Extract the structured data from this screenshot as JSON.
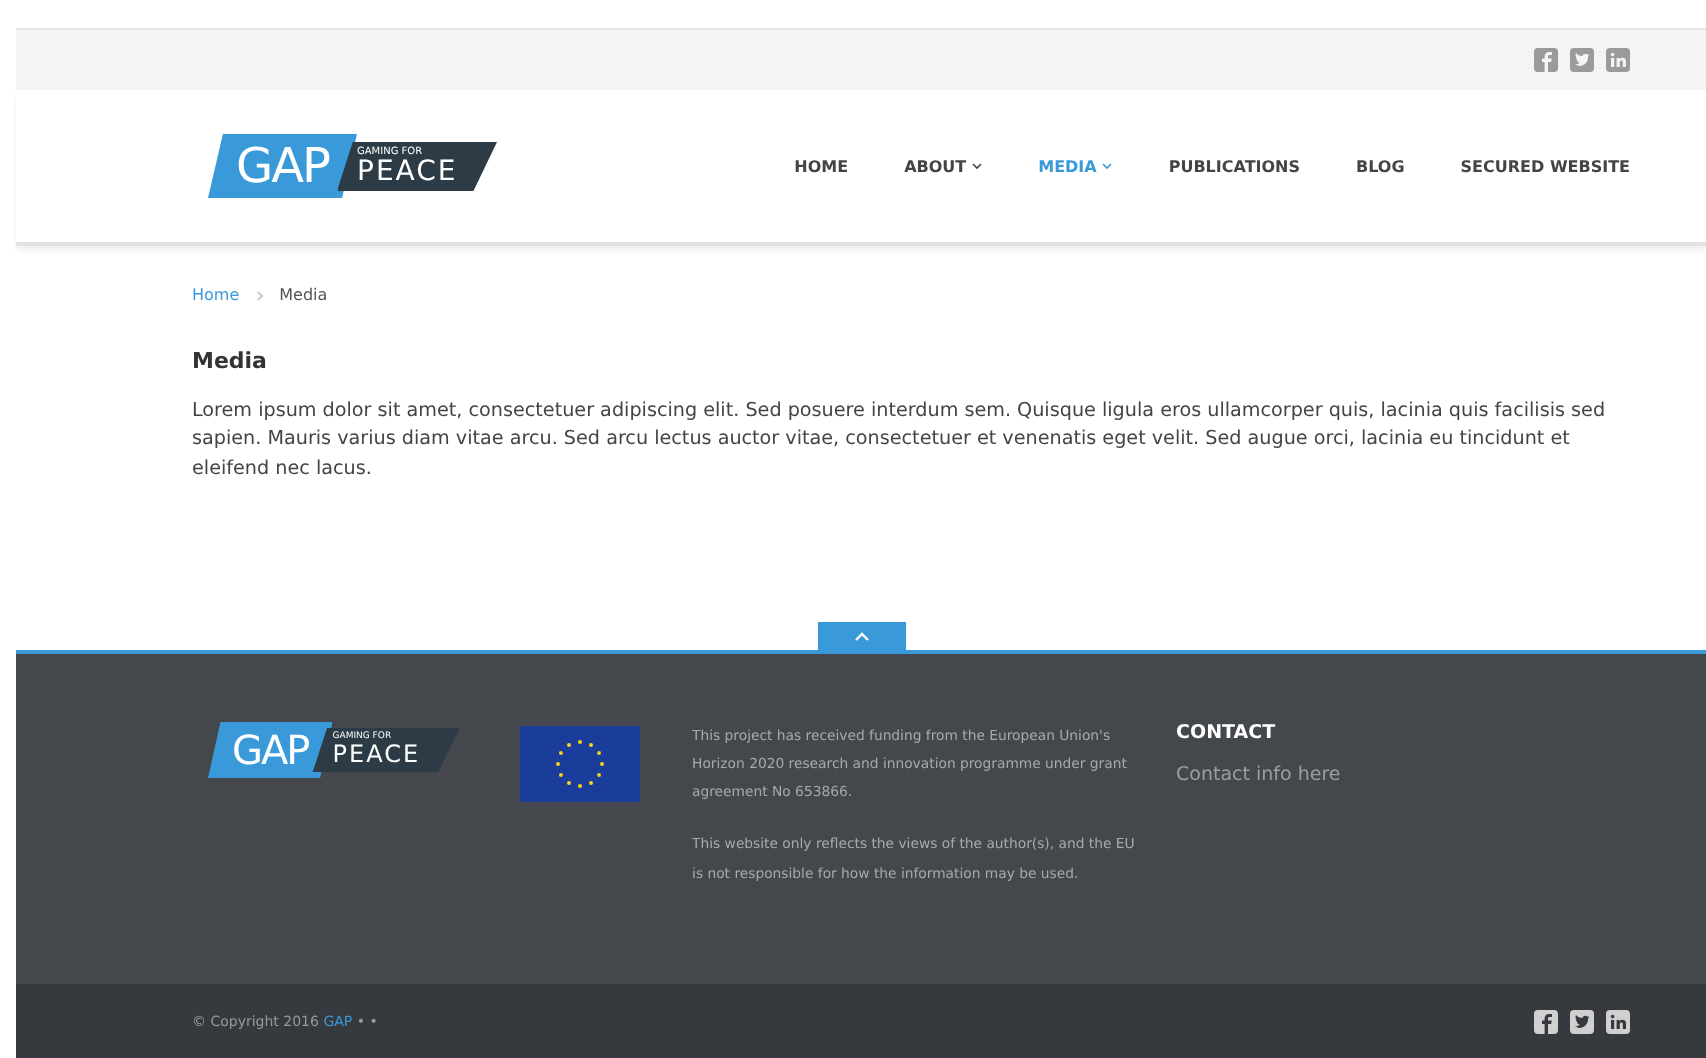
{
  "logo": {
    "mark": "GAP",
    "tagline_top": "GAMING FOR",
    "tagline_bottom": "PEACE"
  },
  "nav": [
    {
      "label": "HOME",
      "dropdown": false,
      "selected": false
    },
    {
      "label": "ABOUT",
      "dropdown": true,
      "selected": false
    },
    {
      "label": "MEDIA",
      "dropdown": true,
      "selected": true
    },
    {
      "label": "PUBLICATIONS",
      "dropdown": false,
      "selected": false
    },
    {
      "label": "BLOG",
      "dropdown": false,
      "selected": false
    },
    {
      "label": "SECURED WEBSITE",
      "dropdown": false,
      "selected": false
    }
  ],
  "breadcrumb": [
    {
      "label": "Home",
      "link": true
    },
    {
      "label": "Media",
      "link": false
    }
  ],
  "page_title": "Media",
  "body": "Lorem ipsum dolor sit amet, consectetuer adipiscing elit. Sed posuere interdum sem. Quisque ligula eros ullamcorper quis, lacinia quis facilisis sed sapien. Mauris varius diam vitae arcu. Sed arcu lectus auctor vitae, consectetuer et venenatis eget velit. Sed augue orci, lacinia eu tincidunt et eleifend nec lacus.",
  "footer": {
    "logo": {
      "mark": "GAP",
      "tagline_top": "GAMING FOR",
      "tagline_bottom": "PEACE"
    },
    "funding": [
      "This project has received funding from the European Union's Horizon 2020 research and innovation programme under grant agreement No 653866.",
      "This website only reflects the views of the author(s), and the EU is not responsible for how the information may be used."
    ],
    "contact_title": "CONTACT",
    "contact_text": "Contact info here"
  },
  "copyright": {
    "text": "© Copyright 2016",
    "link": "GAP",
    "suffix": "• •"
  }
}
